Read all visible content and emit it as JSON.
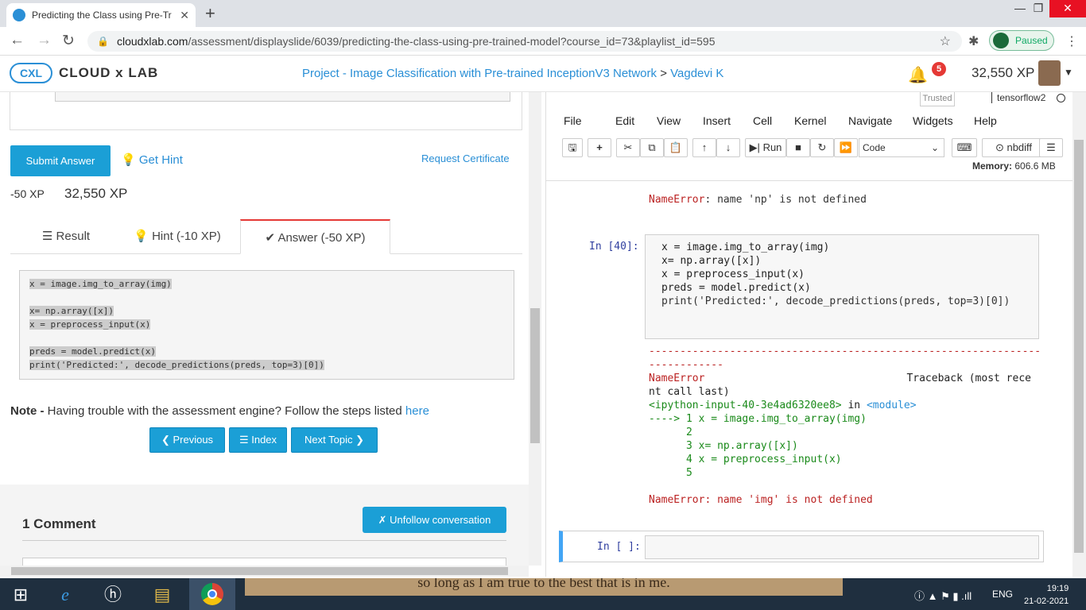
{
  "browser": {
    "tab_title": "Predicting the Class using Pre-Tr",
    "url_host": "cloudxlab.com",
    "url_path": "/assessment/displayslide/6039/predicting-the-class-using-pre-trained-model?course_id=73&playlist_id=595",
    "profile_label": "Paused"
  },
  "site": {
    "logo_text": "CLOUD x LAB",
    "breadcrumb_project": "Project - Image Classification with Pre-trained InceptionV3 Network",
    "breadcrumb_sep": ">",
    "breadcrumb_user": "Vagdevi K",
    "notif_count": "5",
    "xp": "32,550 XP"
  },
  "assessment": {
    "submit_label": "Submit Answer",
    "hint_label": "Get Hint",
    "request_cert": "Request Certificate",
    "xp_delta": "-50 XP",
    "xp_total": "32,550 XP",
    "tabs": [
      {
        "label": "Result"
      },
      {
        "label": "Hint (-10 XP)"
      },
      {
        "label": "Answer (-50 XP)"
      }
    ],
    "answer_code": [
      "x = image.img_to_array(img)",
      "",
      "x= np.array([x])",
      "x = preprocess_input(x)",
      "",
      "preds = model.predict(x)",
      "print('Predicted:', decode_predictions(preds, top=3)[0])"
    ],
    "note_label": "Note -",
    "note_text": " Having trouble with the assessment engine? Follow the steps listed ",
    "note_link": "here",
    "prev_label": "Previous",
    "index_label": "Index",
    "next_label": "Next Topic",
    "comments_title": "1 Comment",
    "unfollow_label": "Unfollow conversation"
  },
  "jupyter": {
    "trusted": "Trusted",
    "kernel": "tensorflow2",
    "menu": [
      "File",
      "Edit",
      "View",
      "Insert",
      "Cell",
      "Kernel",
      "Navigate",
      "Widgets",
      "Help"
    ],
    "run_label": "Run",
    "cell_type": "Code",
    "nbdiff_label": "nbdiff",
    "memory_label": "Memory:",
    "memory_value": "606.6 MB",
    "prev_error": "NameError: name 'np' is not defined",
    "in_prompt": "In [40]:",
    "cell_code": [
      "x = image.img_to_array(img)",
      "",
      "x= np.array([x])",
      "x = preprocess_input(x)",
      "",
      "preds = model.predict(x)",
      "print('Predicted:', decode_predictions(preds, top=3)[0])"
    ],
    "dash_line1": "---------------------------------------------------------------",
    "dash_line2": "------------",
    "tb_name": "NameError",
    "tb_head": "Traceback (most rece",
    "tb_head2": "nt call last)",
    "tb_input": "<ipython-input-40-3e4ad6320ee8>",
    "tb_in": " in ",
    "tb_module": "<module>",
    "tb_arrow": "----> 1 x = image.img_to_array(img)",
    "tb_l2": "      2",
    "tb_l3": "      3 x= np.array([x])",
    "tb_l4": "      4 x = preprocess_input(x)",
    "tb_l5": "      5",
    "final_error": "NameError: name 'img' is not defined",
    "new_prompt": "In [ ]:"
  },
  "taskbar": {
    "wallpaper_text": "so long as I am true to the best that is in me.",
    "lang": "ENG",
    "time": "19:19",
    "date": "21-02-2021"
  }
}
